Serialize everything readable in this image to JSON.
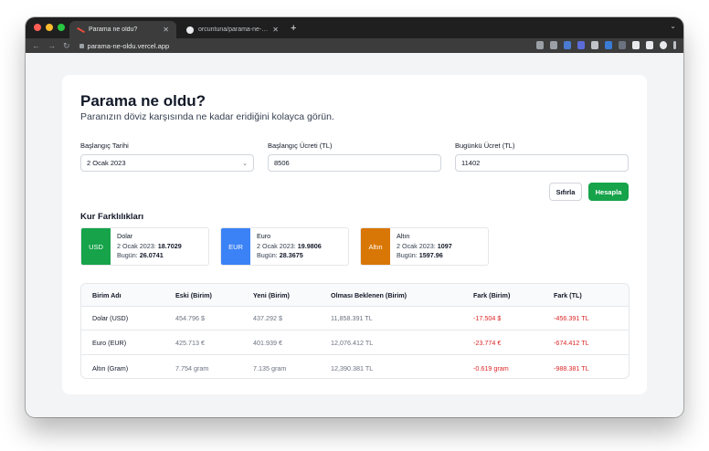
{
  "browser": {
    "tabs": [
      {
        "title": "Parama ne oldu?",
        "active": true
      },
      {
        "title": "orcuntuna/parama-ne-oldu: Pa",
        "active": false
      }
    ],
    "new_tab": "+",
    "url": "parama-ne-oldu.vercel.app"
  },
  "page": {
    "title": "Parama ne oldu?",
    "subtitle": "Paranızın döviz karşısında ne kadar eridiğini kolayca görün.",
    "form": {
      "start_date_label": "Başlangıç Tarihi",
      "start_date_value": "2 Ocak 2023",
      "start_wage_label": "Başlangıç Ücreti (TL)",
      "start_wage_value": "8506",
      "current_wage_label": "Bugünkü Ücret (TL)",
      "current_wage_value": "11402"
    },
    "buttons": {
      "reset": "Sıfırla",
      "calculate": "Hesapla"
    },
    "rates_title": "Kur Farklılıkları",
    "rates": [
      {
        "code": "USD",
        "name": "Dolar",
        "then_label": "2 Ocak 2023:",
        "then_value": "18.7029",
        "now_label": "Bugün:",
        "now_value": "26.0741",
        "color": "#16a34a"
      },
      {
        "code": "EUR",
        "name": "Euro",
        "then_label": "2 Ocak 2023:",
        "then_value": "19.9806",
        "now_label": "Bugün:",
        "now_value": "28.3675",
        "color": "#3b82f6"
      },
      {
        "code": "Altın",
        "name": "Altın",
        "then_label": "2 Ocak 2023:",
        "then_value": "1097",
        "now_label": "Bugün:",
        "now_value": "1597.96",
        "color": "#d97706"
      }
    ],
    "table": {
      "headers": [
        "Birim Adı",
        "Eski (Birim)",
        "Yeni (Birim)",
        "Olması Beklenen (Birim)",
        "Fark (Birim)",
        "Fark (TL)"
      ],
      "rows": [
        [
          "Dolar (USD)",
          "454.796 $",
          "437.292 $",
          "11,858.391 TL",
          "-17.504 $",
          "-456.391 TL"
        ],
        [
          "Euro (EUR)",
          "425.713 €",
          "401.939 €",
          "12,076.412 TL",
          "-23.774 €",
          "-674.412 TL"
        ],
        [
          "Altın (Gram)",
          "7.754 gram",
          "7.135 gram",
          "12,390.381 TL",
          "-0.619 gram",
          "-988.381 TL"
        ]
      ]
    }
  }
}
